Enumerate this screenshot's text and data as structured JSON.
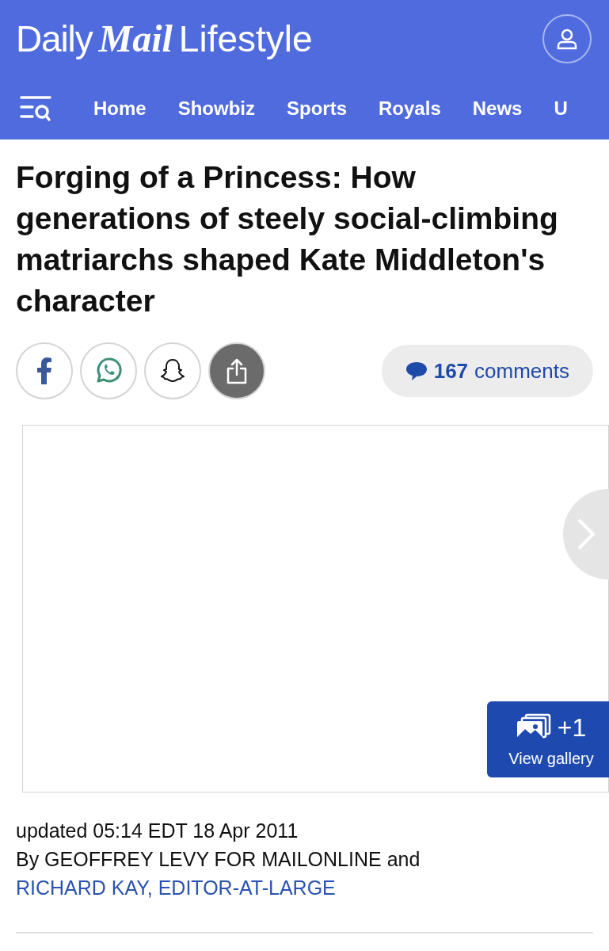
{
  "header": {
    "logo": {
      "first": "Daily",
      "brand": "Mail",
      "section": "Lifestyle"
    }
  },
  "nav": {
    "items": [
      {
        "label": "Home"
      },
      {
        "label": "Showbiz"
      },
      {
        "label": "Sports"
      },
      {
        "label": "Royals"
      },
      {
        "label": "News"
      },
      {
        "label": "U"
      }
    ]
  },
  "article": {
    "headline": "Forging of a Princess: How generations of steely social-climbing matriarchs shaped Kate Middleton's character",
    "share": [
      {
        "kind": "facebook"
      },
      {
        "kind": "whatsapp"
      },
      {
        "kind": "snapchat"
      },
      {
        "kind": "share"
      }
    ],
    "comments": {
      "count": "167",
      "label": "comments"
    },
    "gallery": {
      "count": "+1",
      "label": "View gallery"
    },
    "updated": "updated 05:14 EDT 18 Apr 2011",
    "byline": {
      "prefix": "By GEOFFREY LEVY FOR MAILONLINE and",
      "link": "RICHARD KAY, EDITOR-AT-LARGE"
    }
  }
}
